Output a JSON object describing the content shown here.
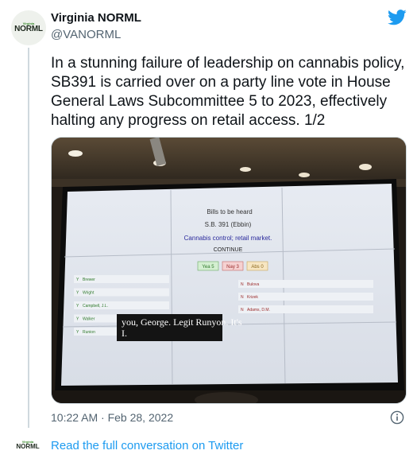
{
  "account": {
    "name": "Virginia NORML",
    "handle": "@VANORML",
    "avatar_small": "Virginia",
    "avatar_big": "NORML"
  },
  "tweet": {
    "text": "In a stunning failure of leadership on cannabis policy, SB391 is carried over on a party line vote in House General Laws Subcommittee 5 to 2023, effectively halting any progress on retail access. 1/2",
    "timestamp": "10:22 AM · Feb 28, 2022"
  },
  "photo": {
    "heading": "Bills to be heard",
    "bill": "S.B. 391 (Ebbin)",
    "subject": "Cannabis control; retail market.",
    "status": "CONTINUE",
    "tally": {
      "yea": "Yea 5",
      "nay": "Nay 3",
      "abs": "Abs 0"
    },
    "yeas": [
      "Brewer",
      "Wright",
      "Campbell, J.L.",
      "Walker",
      "Runion"
    ],
    "yea_mark": "Y",
    "nays": [
      "Bulova",
      "Krizek",
      "Adams, D.M."
    ],
    "nay_mark": "N",
    "caption": "you, George. Legit Runyon. It's I."
  },
  "footer": {
    "read_link": "Read the full conversation on Twitter"
  },
  "icons": {
    "brand": "twitter-bird-icon",
    "info": "info-icon",
    "accent_color": "#1d9bf0"
  }
}
